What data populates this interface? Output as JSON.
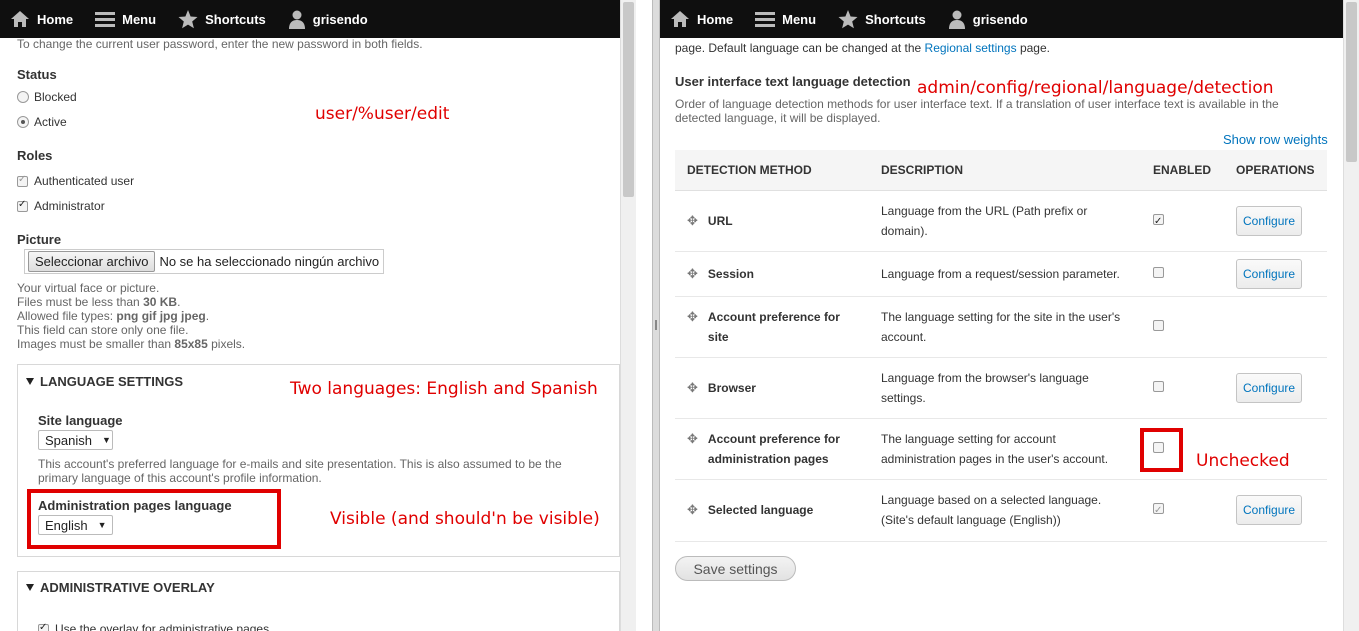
{
  "toolbar": {
    "home": "Home",
    "menu": "Menu",
    "shortcuts": "Shortcuts",
    "user": "grisendo"
  },
  "left": {
    "password_help": "To change the current user password, enter the new password in both fields.",
    "status_label": "Status",
    "status_options": [
      "Blocked",
      "Active"
    ],
    "status_selected": "Active",
    "roles_label": "Roles",
    "roles": [
      "Authenticated user",
      "Administrator"
    ],
    "picture_label": "Picture",
    "file_button": "Seleccionar archivo",
    "file_status": "No se ha seleccionado ningún archivo",
    "picture_help": {
      "line1": "Your virtual face or picture.",
      "line2_pre": "Files must be less than ",
      "line2_bold": "30 KB",
      "line2_post": ".",
      "line3_pre": "Allowed file types: ",
      "line3_bold": "png gif jpg jpeg",
      "line3_post": ".",
      "line4": "This field can store only one file.",
      "line5_pre": "Images must be smaller than ",
      "line5_bold": "85x85",
      "line5_post": " pixels."
    },
    "language_settings": {
      "legend": "LANGUAGE SETTINGS",
      "site_language_label": "Site language",
      "site_language_value": "Spanish",
      "site_language_help": "This account's preferred language for e-mails and site presentation. This is also assumed to be the primary language of this account's profile information.",
      "admin_language_label": "Administration pages language",
      "admin_language_value": "English"
    },
    "admin_overlay": {
      "legend": "ADMINISTRATIVE OVERLAY",
      "option": "Use the overlay for administrative pages."
    },
    "annotations": {
      "path": "user/%user/edit",
      "languages": "Two languages: English and Spanish",
      "visible": "Visible (and should'n be visible)"
    }
  },
  "right": {
    "intro_pre": "page. Default language can be changed at the ",
    "intro_link": "Regional settings",
    "intro_post": " page.",
    "section_title": "User interface text language detection",
    "section_desc": "Order of language detection methods for user interface text. If a translation of user interface text is available in the detected language, it will be displayed.",
    "show_weights": "Show row weights",
    "columns": [
      "Detection method",
      "Description",
      "Enabled",
      "Operations"
    ],
    "rows": [
      {
        "method": "URL",
        "description": "Language from the URL (Path prefix or domain).",
        "enabled": true,
        "operation": "Configure"
      },
      {
        "method": "Session",
        "description": "Language from a request/session parameter.",
        "enabled": false,
        "operation": "Configure"
      },
      {
        "method": "Account preference for site",
        "description": "The language setting for the site in the user's account.",
        "enabled": false,
        "operation": ""
      },
      {
        "method": "Browser",
        "description": "Language from the browser's language settings.",
        "enabled": false,
        "operation": "Configure"
      },
      {
        "method": "Account preference for administration pages",
        "description": "The language setting for account administration pages in the user's account.",
        "enabled": false,
        "operation": ""
      },
      {
        "method": "Selected language",
        "description": "Language based on a selected language. (Site's default language (English))",
        "enabled": true,
        "operation": "Configure"
      }
    ],
    "save_button": "Save settings",
    "annotations": {
      "path": "admin/config/regional/language/detection",
      "unchecked": "Unchecked"
    }
  }
}
